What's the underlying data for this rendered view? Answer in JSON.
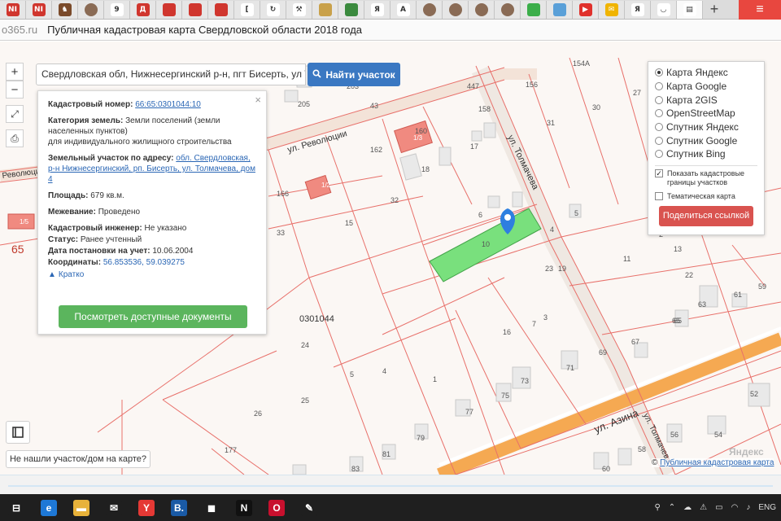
{
  "browser": {
    "tabs": [
      {
        "icon": "ni-icon",
        "label": "NI",
        "color": "#d0362e"
      },
      {
        "icon": "ni-icon",
        "label": "NI",
        "color": "#d0362e"
      },
      {
        "icon": "horse-icon",
        "label": "♞",
        "color": "#7a4a2a"
      },
      {
        "icon": "avatar-icon",
        "label": "",
        "color": "#8a6b55"
      },
      {
        "icon": "nine-icon",
        "label": "9",
        "color": "#ffffff"
      },
      {
        "icon": "doc-icon",
        "label": "Д",
        "color": "#d0362e"
      },
      {
        "icon": "promo-icon",
        "label": "",
        "color": "#d0362e"
      },
      {
        "icon": "promo-icon",
        "label": "",
        "color": "#d0362e"
      },
      {
        "icon": "promo-icon",
        "label": "",
        "color": "#d0362e"
      },
      {
        "icon": "bracket-icon",
        "label": "[",
        "color": "#ffffff"
      },
      {
        "icon": "refresh-icon",
        "label": "↻",
        "color": "#ffffff"
      },
      {
        "icon": "hammer-icon",
        "label": "⚒",
        "color": "#ffffff"
      },
      {
        "icon": "emblem-icon",
        "label": "",
        "color": "#c9a14a"
      },
      {
        "icon": "app-icon",
        "label": "",
        "color": "#3b8a3e"
      },
      {
        "icon": "yandex-icon",
        "label": "Я",
        "color": "#ffffff"
      },
      {
        "icon": "a-icon",
        "label": "A",
        "color": "#ffffff"
      },
      {
        "icon": "avatar-icon",
        "label": "",
        "color": "#8a6b55"
      },
      {
        "icon": "avatar-icon",
        "label": "",
        "color": "#8a6b55"
      },
      {
        "icon": "avatar-icon",
        "label": "",
        "color": "#8a6b55"
      },
      {
        "icon": "avatar-icon",
        "label": "",
        "color": "#8a6b55"
      },
      {
        "icon": "green-circle-icon",
        "label": "",
        "color": "#3cae4a"
      },
      {
        "icon": "chart-icon",
        "label": "",
        "color": "#5aa0d8"
      },
      {
        "icon": "youtube-icon",
        "label": "▶",
        "color": "#e0312c"
      },
      {
        "icon": "mail-icon",
        "label": "✉",
        "color": "#f0b400"
      },
      {
        "icon": "yandex-icon",
        "label": "Я",
        "color": "#ffffff"
      },
      {
        "icon": "loading-icon",
        "label": "◡",
        "color": "#ffffff"
      },
      {
        "icon": "page-icon",
        "label": "▤",
        "color": "#ffffff"
      }
    ],
    "new_tab_label": "+",
    "menu_label": "≡",
    "address_domain": "o365.ru",
    "page_title": "Публичная кадастровая карта Свердловской области 2018 года"
  },
  "search": {
    "value": "Свердловская обл, Нижнесергинский р-н, пгт Бисерть, ул Т",
    "button_label": "Найти участок"
  },
  "controls": {
    "zoom_in": "+",
    "zoom_out": "−",
    "fullscreen": "⤢",
    "print": "⎙"
  },
  "popup": {
    "close": "×",
    "cadastral_label": "Кадастровый номер:",
    "cadastral_value": "66:65:0301044:10",
    "category_label": "Категория земель:",
    "category_value": "Земли поселений (земли населенных пунктов)",
    "category_use": "для индивидуального жилищного строительства",
    "address_label": "Земельный участок по адресу:",
    "address_value": "обл. Свердловская, р-н Нижнесергинский, рп. Бисерть, ул. Толмачева, дом 4",
    "area_label": "Площадь:",
    "area_value": "679 кв.м.",
    "survey_label": "Межевание:",
    "survey_value": "Проведено",
    "engineer_label": "Кадастровый инженер:",
    "engineer_value": "Не указано",
    "status_label": "Статус:",
    "status_value": "Ранее учтенный",
    "date_label": "Дата постановки на учет:",
    "date_value": "10.06.2004",
    "coords_label": "Координаты:",
    "coords_value": "56.853536, 59.039275",
    "briefly": "Кратко",
    "docs_button": "Посмотреть доступные документы"
  },
  "layers": {
    "options": [
      {
        "label": "Карта Яндекс",
        "selected": true
      },
      {
        "label": "Карта Google",
        "selected": false
      },
      {
        "label": "Карта 2GIS",
        "selected": false
      },
      {
        "label": "OpenStreetMap",
        "selected": false
      },
      {
        "label": "Спутник Яндекс",
        "selected": false
      },
      {
        "label": "Спутник Google",
        "selected": false
      },
      {
        "label": "Спутник Bing",
        "selected": false
      }
    ],
    "show_borders": "Показать кадастровые границы участков",
    "show_borders_checked": true,
    "thematic": "Тематическая карта",
    "thematic_checked": false,
    "share_button": "Поделиться ссылкой"
  },
  "map": {
    "streets": {
      "revolution": "ул. Революции",
      "tolmacheva": "ул. Толмачева",
      "azina": "ул. Азина",
      "tolmacheva2": "ул. Толмачева"
    },
    "quarter": "0301044",
    "parcel_numbers": [
      "447",
      "154А",
      "27",
      "203",
      "156",
      "205",
      "43",
      "158",
      "30",
      "160",
      "31",
      "162",
      "17",
      "18",
      "166",
      "32",
      "6",
      "5",
      "15",
      "33",
      "4",
      "10",
      "19",
      "11",
      "23",
      "65",
      "24",
      "7",
      "3",
      "16",
      "25",
      "4",
      "5",
      "1",
      "26",
      "177",
      "79",
      "77",
      "75",
      "73",
      "71",
      "69",
      "67",
      "65",
      "63",
      "61",
      "59",
      "52",
      "54",
      "56",
      "58",
      "60",
      "83",
      "81",
      "22",
      "13",
      "2",
      "1"
    ],
    "building_labels": [
      "1/3",
      "1/2",
      "1/5"
    ],
    "not_found": "Не нашли участок/дом на карте?",
    "yandex_logo": "Яндекс",
    "attribution_prefix": "©",
    "attribution_link": "Публичная кадастровая карта",
    "left_number": "65",
    "left_street_fragment": "Революции",
    "selected_color": "#79e07d",
    "boundary_color": "#e8706a",
    "pin_color": "#2e7fe0"
  },
  "taskbar": {
    "icons": [
      {
        "name": "task-view-icon",
        "label": "⊟",
        "color": "#1f1f1f"
      },
      {
        "name": "edge-icon",
        "label": "e",
        "color": "#1e78d6"
      },
      {
        "name": "explorer-icon",
        "label": "▬",
        "color": "#e8b23a"
      },
      {
        "name": "mail-icon",
        "label": "✉",
        "color": "#1f1f1f"
      },
      {
        "name": "yandex-browser-icon",
        "label": "Y",
        "color": "#e53935"
      },
      {
        "name": "b-app-icon",
        "label": "B.",
        "color": "#1a5aa5"
      },
      {
        "name": "store-icon",
        "label": "◼",
        "color": "#1f1f1f"
      },
      {
        "name": "netflix-icon",
        "label": "N",
        "color": "#111111"
      },
      {
        "name": "opera-icon",
        "label": "O",
        "color": "#c8102e"
      },
      {
        "name": "paint-icon",
        "label": "✎",
        "color": "#1f1f1f"
      }
    ],
    "tray": {
      "lang": "ENG",
      "items": [
        "person-icon",
        "chevron-up-icon",
        "onedrive-icon",
        "alert-icon",
        "network-icon",
        "wifi-icon",
        "volume-icon"
      ]
    }
  }
}
